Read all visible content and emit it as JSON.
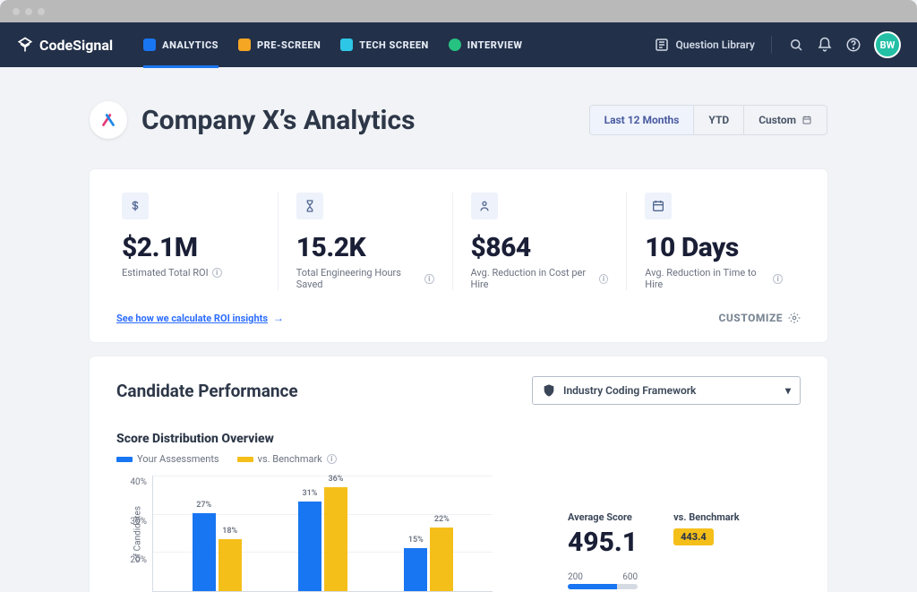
{
  "brand": "CodeSignal",
  "nav_tabs": [
    {
      "label": "ANALYTICS",
      "color": "#1976f2"
    },
    {
      "label": "PRE-SCREEN",
      "color": "#f5a623"
    },
    {
      "label": "TECH SCREEN",
      "color": "#2ec6e6"
    },
    {
      "label": "INTERVIEW",
      "color": "#26c281"
    }
  ],
  "question_library": "Question Library",
  "avatar_initials": "BW",
  "page_title": "Company X’s Analytics",
  "timeframe": {
    "options": [
      "Last 12 Months",
      "YTD",
      "Custom"
    ],
    "selected": 0
  },
  "kpis": [
    {
      "value": "$2.1M",
      "label": "Estimated Total ROI"
    },
    {
      "value": "15.2K",
      "label": "Total Engineering Hours Saved"
    },
    {
      "value": "$864",
      "label": "Avg. Reduction in Cost per Hire"
    },
    {
      "value": "10 Days",
      "label": "Avg. Reduction in Time to Hire"
    }
  ],
  "roi_link": "See how we calculate ROI insights",
  "customize": "CUSTOMIZE",
  "perf": {
    "heading": "Candidate Performance",
    "framework": "Industry Coding Framework",
    "chart_title": "Score Distribution Overview",
    "legend": [
      "Your Assessments",
      "vs. Benchmark"
    ],
    "avg_label": "Average Score",
    "avg_value": "495.1",
    "bench_label": "vs. Benchmark",
    "bench_value": "443.4",
    "scale": [
      "200",
      "600"
    ]
  },
  "chart_data": {
    "type": "bar",
    "title": "Score Distribution Overview",
    "ylabel": "of Candidates",
    "ylim": [
      0,
      40
    ],
    "yticks": [
      40,
      30,
      20
    ],
    "series": [
      {
        "name": "Your Assessments",
        "color": "#1976f2",
        "values": [
          27,
          31,
          15
        ]
      },
      {
        "name": "vs. Benchmark",
        "color": "#f5bf1a",
        "values": [
          18,
          36,
          22
        ]
      }
    ],
    "categories": [
      "",
      "",
      ""
    ]
  }
}
